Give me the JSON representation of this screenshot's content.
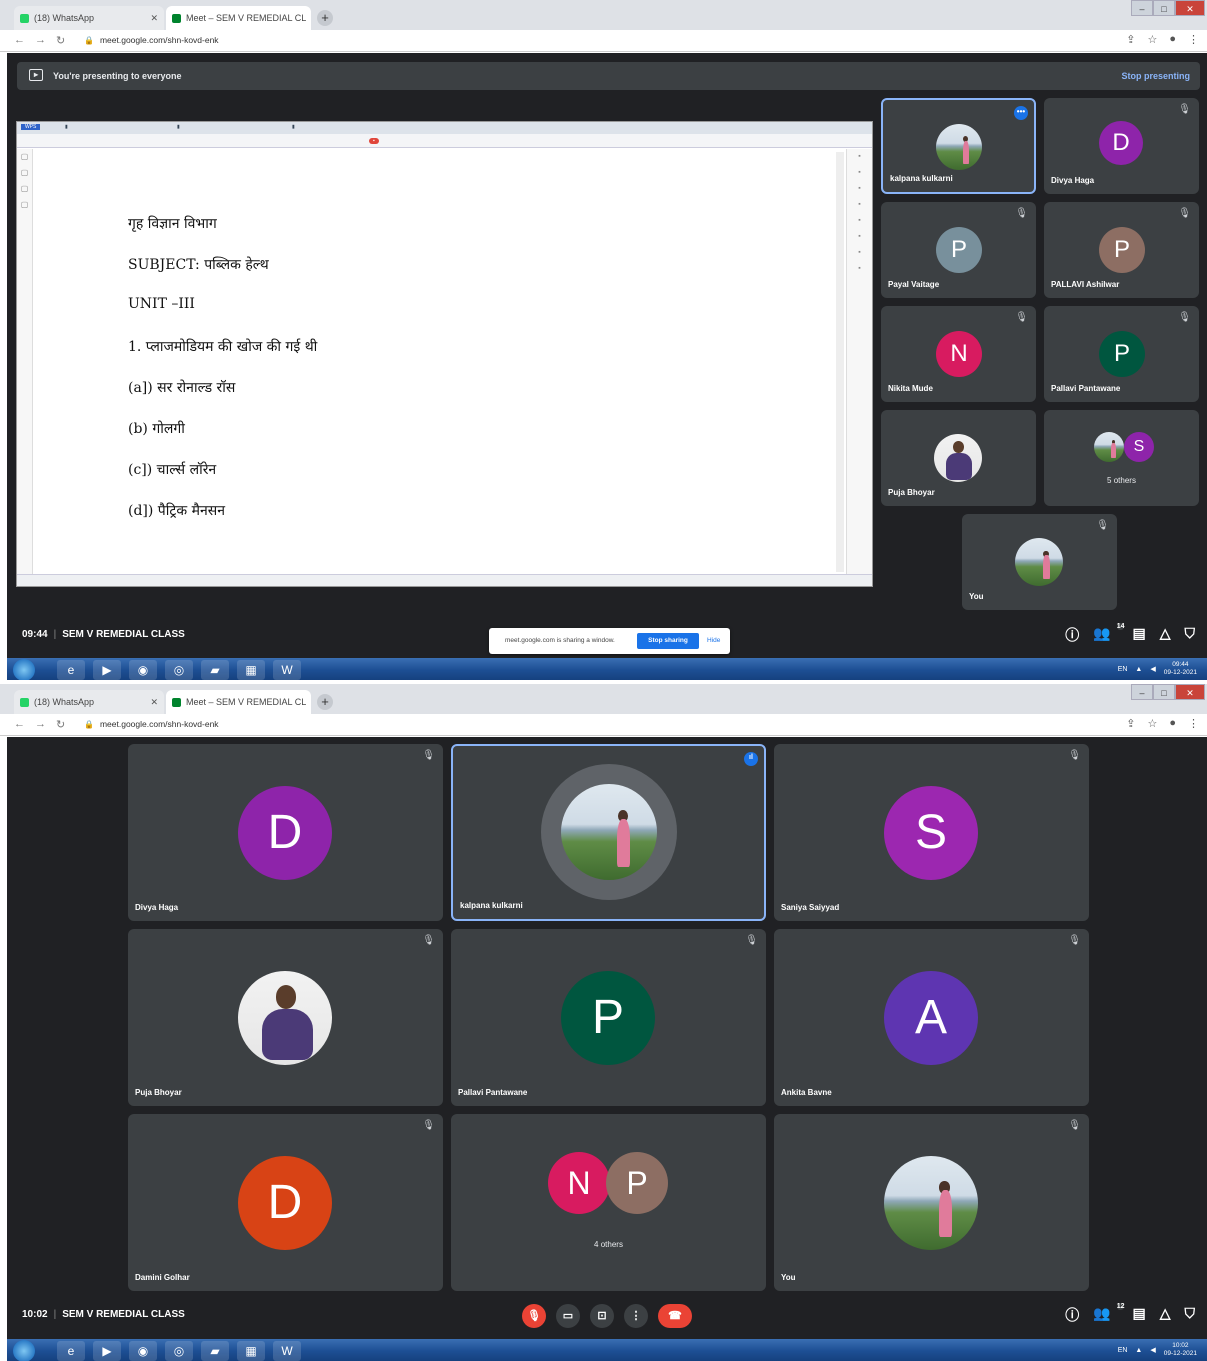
{
  "screenshot1": {
    "browser": {
      "tabs": [
        "(18) WhatsApp",
        "Meet – SEM V REMEDIAL CL"
      ],
      "url": "meet.google.com/shn-kovd-enk"
    },
    "presenting_bar": {
      "text": "You're presenting to everyone",
      "stop": "Stop presenting"
    },
    "document": {
      "lines": [
        "गृह विज्ञान विभाग",
        "SUBJECT: पब्लिक हेल्थ",
        "UNIT –III",
        "1. प्लाजमोडियम की खोज की गई थी",
        "(a]) सर रोनाल्ड रॉस",
        "(b) गोलगी",
        "(c]) चार्ल्स लॉरेन",
        "(d]) पैट्रिक मैनसन"
      ]
    },
    "participants": [
      {
        "name": "kalpana kulkarni",
        "kind": "photo",
        "active": true
      },
      {
        "name": "Divya Haga",
        "kind": "letter",
        "letter": "D",
        "color": "#8e24aa"
      },
      {
        "name": "Payal Vaitage",
        "kind": "letter",
        "letter": "P",
        "color": "#78909c"
      },
      {
        "name": "PALLAVI Ashilwar",
        "kind": "letter",
        "letter": "P",
        "color": "#8d6e63"
      },
      {
        "name": "Nikita Mude",
        "kind": "letter",
        "letter": "N",
        "color": "#d81b60"
      },
      {
        "name": "Pallavi Pantawane",
        "kind": "letter",
        "letter": "P",
        "color": "#00563f"
      },
      {
        "name": "Puja Bhoyar",
        "kind": "photo"
      },
      {
        "name": "",
        "others": "5 others",
        "letter": "S",
        "color": "#8e24aa"
      },
      {
        "name": "You",
        "kind": "photo"
      }
    ],
    "meeting": {
      "time": "09:44",
      "title": "SEM V REMEDIAL CLASS",
      "people_count": "14"
    },
    "share_note": {
      "message": "meet.google.com is sharing a window.",
      "stop": "Stop sharing",
      "hide": "Hide"
    },
    "taskbar": {
      "lang": "EN",
      "time": "09:44",
      "date": "09-12-2021"
    }
  },
  "screenshot2": {
    "browser": {
      "tabs": [
        "(18) WhatsApp",
        "Meet – SEM V REMEDIAL CL"
      ],
      "url": "meet.google.com/shn-kovd-enk"
    },
    "participants": [
      {
        "name": "Divya Haga",
        "kind": "letter",
        "letter": "D",
        "color": "#8e24aa"
      },
      {
        "name": "kalpana kulkarni",
        "kind": "photo",
        "active": true
      },
      {
        "name": "Saniya Saiyyad",
        "kind": "letter",
        "letter": "S",
        "color": "#9c27b0"
      },
      {
        "name": "Puja Bhoyar",
        "kind": "photo"
      },
      {
        "name": "Pallavi Pantawane",
        "kind": "letter",
        "letter": "P",
        "color": "#00563f"
      },
      {
        "name": "Ankita Bavne",
        "kind": "letter",
        "letter": "A",
        "color": "#5e35b1"
      },
      {
        "name": "Damini Golhar",
        "kind": "letter",
        "letter": "D",
        "color": "#d84315"
      },
      {
        "name": "",
        "others": "4 others",
        "letters": [
          "N",
          "P"
        ],
        "colors": [
          "#d81b60",
          "#8d6e63"
        ]
      },
      {
        "name": "You",
        "kind": "photo"
      }
    ],
    "meeting": {
      "time": "10:02",
      "title": "SEM V REMEDIAL CLASS",
      "people_count": "12"
    },
    "taskbar": {
      "lang": "EN",
      "time": "10:02",
      "date": "09-12-2021"
    }
  },
  "colors": {
    "meet_bg": "#202124",
    "tile_bg": "#3c4043",
    "accent": "#8ab4f8",
    "end_call": "#ea4335"
  }
}
